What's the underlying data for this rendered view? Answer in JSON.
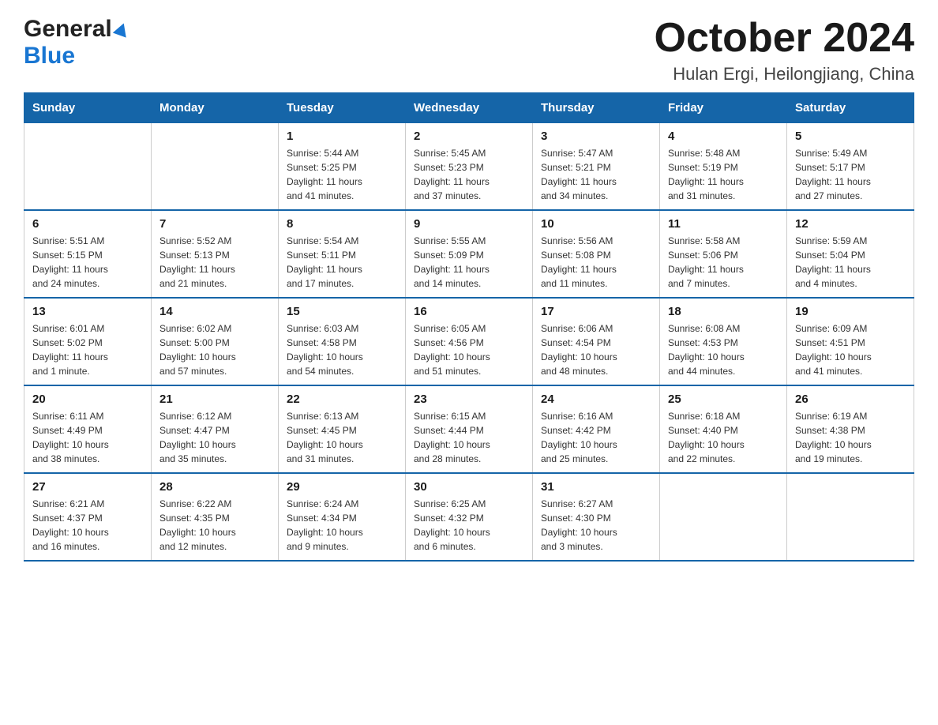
{
  "header": {
    "logo_general": "General",
    "logo_blue": "Blue",
    "month_title": "October 2024",
    "location": "Hulan Ergi, Heilongjiang, China"
  },
  "calendar": {
    "days_of_week": [
      "Sunday",
      "Monday",
      "Tuesday",
      "Wednesday",
      "Thursday",
      "Friday",
      "Saturday"
    ],
    "weeks": [
      [
        {
          "day": "",
          "info": ""
        },
        {
          "day": "",
          "info": ""
        },
        {
          "day": "1",
          "info": "Sunrise: 5:44 AM\nSunset: 5:25 PM\nDaylight: 11 hours\nand 41 minutes."
        },
        {
          "day": "2",
          "info": "Sunrise: 5:45 AM\nSunset: 5:23 PM\nDaylight: 11 hours\nand 37 minutes."
        },
        {
          "day": "3",
          "info": "Sunrise: 5:47 AM\nSunset: 5:21 PM\nDaylight: 11 hours\nand 34 minutes."
        },
        {
          "day": "4",
          "info": "Sunrise: 5:48 AM\nSunset: 5:19 PM\nDaylight: 11 hours\nand 31 minutes."
        },
        {
          "day": "5",
          "info": "Sunrise: 5:49 AM\nSunset: 5:17 PM\nDaylight: 11 hours\nand 27 minutes."
        }
      ],
      [
        {
          "day": "6",
          "info": "Sunrise: 5:51 AM\nSunset: 5:15 PM\nDaylight: 11 hours\nand 24 minutes."
        },
        {
          "day": "7",
          "info": "Sunrise: 5:52 AM\nSunset: 5:13 PM\nDaylight: 11 hours\nand 21 minutes."
        },
        {
          "day": "8",
          "info": "Sunrise: 5:54 AM\nSunset: 5:11 PM\nDaylight: 11 hours\nand 17 minutes."
        },
        {
          "day": "9",
          "info": "Sunrise: 5:55 AM\nSunset: 5:09 PM\nDaylight: 11 hours\nand 14 minutes."
        },
        {
          "day": "10",
          "info": "Sunrise: 5:56 AM\nSunset: 5:08 PM\nDaylight: 11 hours\nand 11 minutes."
        },
        {
          "day": "11",
          "info": "Sunrise: 5:58 AM\nSunset: 5:06 PM\nDaylight: 11 hours\nand 7 minutes."
        },
        {
          "day": "12",
          "info": "Sunrise: 5:59 AM\nSunset: 5:04 PM\nDaylight: 11 hours\nand 4 minutes."
        }
      ],
      [
        {
          "day": "13",
          "info": "Sunrise: 6:01 AM\nSunset: 5:02 PM\nDaylight: 11 hours\nand 1 minute."
        },
        {
          "day": "14",
          "info": "Sunrise: 6:02 AM\nSunset: 5:00 PM\nDaylight: 10 hours\nand 57 minutes."
        },
        {
          "day": "15",
          "info": "Sunrise: 6:03 AM\nSunset: 4:58 PM\nDaylight: 10 hours\nand 54 minutes."
        },
        {
          "day": "16",
          "info": "Sunrise: 6:05 AM\nSunset: 4:56 PM\nDaylight: 10 hours\nand 51 minutes."
        },
        {
          "day": "17",
          "info": "Sunrise: 6:06 AM\nSunset: 4:54 PM\nDaylight: 10 hours\nand 48 minutes."
        },
        {
          "day": "18",
          "info": "Sunrise: 6:08 AM\nSunset: 4:53 PM\nDaylight: 10 hours\nand 44 minutes."
        },
        {
          "day": "19",
          "info": "Sunrise: 6:09 AM\nSunset: 4:51 PM\nDaylight: 10 hours\nand 41 minutes."
        }
      ],
      [
        {
          "day": "20",
          "info": "Sunrise: 6:11 AM\nSunset: 4:49 PM\nDaylight: 10 hours\nand 38 minutes."
        },
        {
          "day": "21",
          "info": "Sunrise: 6:12 AM\nSunset: 4:47 PM\nDaylight: 10 hours\nand 35 minutes."
        },
        {
          "day": "22",
          "info": "Sunrise: 6:13 AM\nSunset: 4:45 PM\nDaylight: 10 hours\nand 31 minutes."
        },
        {
          "day": "23",
          "info": "Sunrise: 6:15 AM\nSunset: 4:44 PM\nDaylight: 10 hours\nand 28 minutes."
        },
        {
          "day": "24",
          "info": "Sunrise: 6:16 AM\nSunset: 4:42 PM\nDaylight: 10 hours\nand 25 minutes."
        },
        {
          "day": "25",
          "info": "Sunrise: 6:18 AM\nSunset: 4:40 PM\nDaylight: 10 hours\nand 22 minutes."
        },
        {
          "day": "26",
          "info": "Sunrise: 6:19 AM\nSunset: 4:38 PM\nDaylight: 10 hours\nand 19 minutes."
        }
      ],
      [
        {
          "day": "27",
          "info": "Sunrise: 6:21 AM\nSunset: 4:37 PM\nDaylight: 10 hours\nand 16 minutes."
        },
        {
          "day": "28",
          "info": "Sunrise: 6:22 AM\nSunset: 4:35 PM\nDaylight: 10 hours\nand 12 minutes."
        },
        {
          "day": "29",
          "info": "Sunrise: 6:24 AM\nSunset: 4:34 PM\nDaylight: 10 hours\nand 9 minutes."
        },
        {
          "day": "30",
          "info": "Sunrise: 6:25 AM\nSunset: 4:32 PM\nDaylight: 10 hours\nand 6 minutes."
        },
        {
          "day": "31",
          "info": "Sunrise: 6:27 AM\nSunset: 4:30 PM\nDaylight: 10 hours\nand 3 minutes."
        },
        {
          "day": "",
          "info": ""
        },
        {
          "day": "",
          "info": ""
        }
      ]
    ]
  }
}
